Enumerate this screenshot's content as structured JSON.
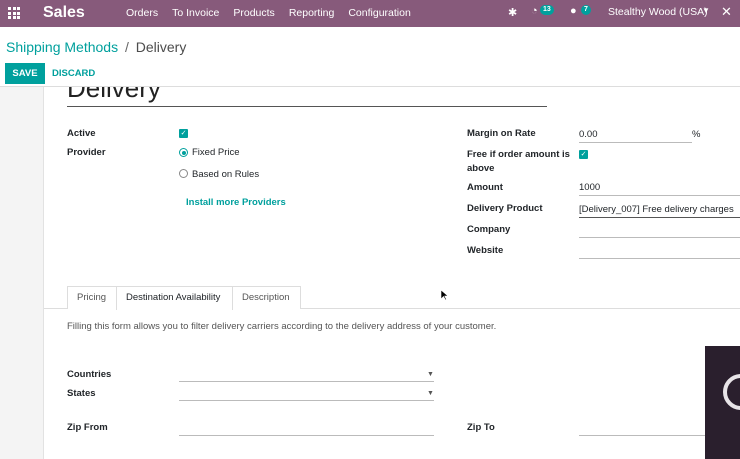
{
  "navbar": {
    "app_name": "Sales",
    "menu": [
      "Orders",
      "To Invoice",
      "Products",
      "Reporting",
      "Configuration"
    ],
    "activity_count": "13",
    "message_count": "7",
    "company": "Stealthy Wood (USA)"
  },
  "breadcrumb": {
    "parent": "Shipping Methods",
    "separator": "/",
    "current": "Delivery"
  },
  "buttons": {
    "save": "SAVE",
    "discard": "DISCARD"
  },
  "form": {
    "title": "Delivery",
    "active": {
      "label": "Active",
      "checked": true
    },
    "provider": {
      "label": "Provider",
      "options": [
        {
          "label": "Fixed Price",
          "selected": true
        },
        {
          "label": "Based on Rules",
          "selected": false
        }
      ],
      "install_link": "Install more Providers"
    },
    "margin": {
      "label": "Margin on Rate",
      "value": "0.00",
      "unit": "%"
    },
    "free_if": {
      "label_line1": "Free if order amount is",
      "label_line2": "above",
      "checked": true
    },
    "amount": {
      "label": "Amount",
      "value": "1000"
    },
    "delivery_product": {
      "label": "Delivery Product",
      "value": "[Delivery_007] Free delivery charges"
    },
    "company": {
      "label": "Company",
      "value": ""
    },
    "website": {
      "label": "Website",
      "value": ""
    }
  },
  "tabs": [
    {
      "label": "Pricing",
      "active": false
    },
    {
      "label": "Destination Availability",
      "active": true
    },
    {
      "label": "Description",
      "active": false
    }
  ],
  "destination": {
    "help_text": "Filling this form allows you to filter delivery carriers according to the delivery address of your customer.",
    "countries_label": "Countries",
    "states_label": "States",
    "zip_from_label": "Zip From",
    "zip_to_label": "Zip To"
  },
  "colors": {
    "navbar": "#875a7b",
    "accent": "#00a09d"
  }
}
